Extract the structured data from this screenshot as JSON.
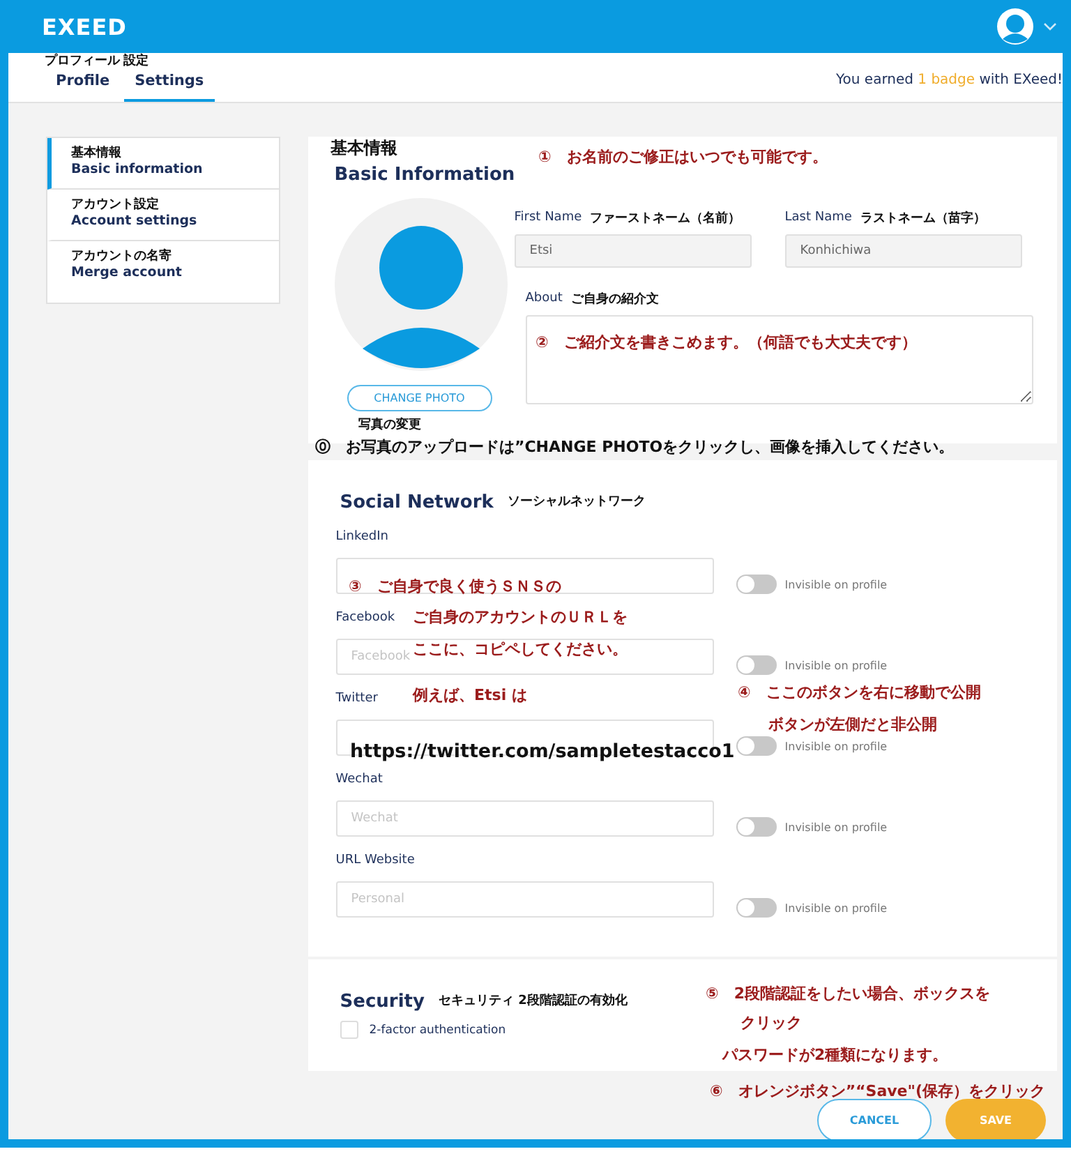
{
  "header": {
    "logo": "EXEED"
  },
  "tabs": [
    {
      "label": "Profile",
      "note": "プロフィール",
      "selected": false
    },
    {
      "label": "Settings",
      "note": "設定",
      "selected": true
    }
  ],
  "badge_message": {
    "before": "You earned ",
    "highlight": "1 badge",
    "after": " with EXeed!"
  },
  "sidebar": {
    "items": [
      {
        "note": "基本情報",
        "label": "Basic information",
        "selected": true
      },
      {
        "note": "アカウント設定",
        "label": "Account settings",
        "selected": false
      },
      {
        "note": "アカウントの名寄",
        "label": "Merge account",
        "selected": false
      }
    ]
  },
  "basic_info": {
    "note": "基本情報",
    "title": "Basic Information",
    "change_photo": "CHANGE PHOTO",
    "photo_note": "写真の変更",
    "first_name": {
      "label": "First Name",
      "note": "ファーストネーム（名前）",
      "value": "Etsi"
    },
    "last_name": {
      "label": "Last Name",
      "note": "ラストネーム（苗字）",
      "value": "Konhichiwa"
    },
    "about": {
      "label": "About",
      "note": "ご自身の紹介文"
    }
  },
  "social": {
    "title": "Social Network",
    "note": "ソーシャルネットワーク",
    "rows": [
      {
        "label": "LinkedIn",
        "visibility": "Invisible on profile",
        "on": false
      },
      {
        "label": "Facebook",
        "placeholder": "Facebook",
        "visibility": "Invisible on profile",
        "on": false
      },
      {
        "label": "Twitter",
        "visibility": "Invisible on profile",
        "on": false
      },
      {
        "label": "Wechat",
        "placeholder": "Wechat",
        "visibility": "Invisible on profile",
        "on": false
      },
      {
        "label": "URL Website",
        "placeholder": "Personal",
        "visibility": "Invisible on profile",
        "on": false
      }
    ]
  },
  "security": {
    "title": "Security",
    "note": "セキュリティ 2段階認証の有効化",
    "option": {
      "label": "2-factor authentication",
      "checked": false
    }
  },
  "buttons": {
    "cancel": "CANCEL",
    "save": "SAVE"
  },
  "annotations": [
    {
      "text": "①　お名前のご修正はいつでも可能です。"
    },
    {
      "text": "②　ご紹介文を書きこめます。（何語でも大丈夫です）"
    },
    {
      "text": "⓪　お写真のアップロードは”CHANGE PHOTOをクリックし、画像を挿入してください。"
    },
    {
      "text": "③　ご自身で良く使うＳＮＳの"
    },
    {
      "text": "ご自身のアカウントのＵＲＬを"
    },
    {
      "text": "ここに、コピペしてください。"
    },
    {
      "text": "例えば、Etsi は"
    },
    {
      "text": "https://twitter.com/sampletestacco1"
    },
    {
      "text": "④　ここのボタンを右に移動で公開"
    },
    {
      "text": "ボタンが左側だと非公開"
    },
    {
      "text": "⑤　2段階認証をしたい場合、ボックスを"
    },
    {
      "text": "クリック"
    },
    {
      "text": "パスワードが2種類になります。"
    },
    {
      "text": "⑥　オレンジボタン”“Save\"(保存）をクリック"
    }
  ]
}
